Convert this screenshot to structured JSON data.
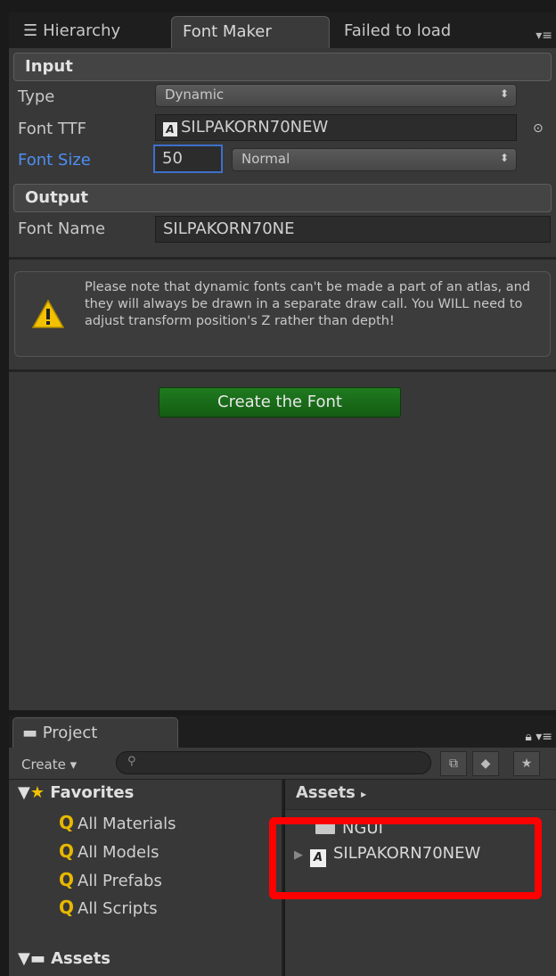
{
  "tabs": [
    {
      "label": "Hierarchy",
      "icon": "hierarchy-icon"
    },
    {
      "label": "Font Maker"
    },
    {
      "label": "Failed to load"
    }
  ],
  "font_maker": {
    "input_header": "Input",
    "type_label": "Type",
    "type_value": "Dynamic",
    "font_ttf_label": "Font TTF",
    "font_ttf_value": "SILPAKORN70NEW",
    "font_size_label": "Font Size",
    "font_size_value": "50",
    "font_style_value": "Normal",
    "output_header": "Output",
    "font_name_label": "Font Name",
    "font_name_value": "SILPAKORN70NE",
    "warning": "Please note that dynamic fonts can't be made a part of an atlas, and they will always be drawn in a separate draw call. You WILL need to adjust transform position's Z rather than depth!",
    "create_button": "Create the Font"
  },
  "project": {
    "tab_label": "Project",
    "create_label": "Create",
    "favorites_label": "Favorites",
    "favorites": [
      "All Materials",
      "All Models",
      "All Prefabs",
      "All Scripts"
    ],
    "assets_root_label": "Assets",
    "breadcrumb": "Assets",
    "assets": [
      {
        "name": "NGUI",
        "kind": "folder"
      },
      {
        "name": "SILPAKORN70NEW",
        "kind": "font"
      }
    ]
  },
  "colors": {
    "highlight": "#ff0000",
    "create_button": "#1f7a1f",
    "focus_label": "#4d8ef2"
  }
}
